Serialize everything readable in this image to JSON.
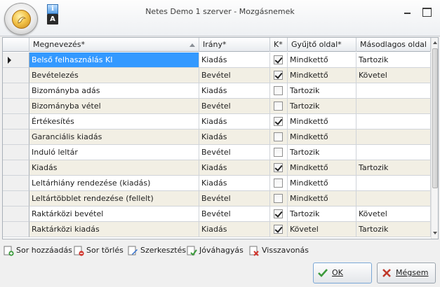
{
  "window": {
    "title": "Netes Demo 1 szerver - Mozgásnemek",
    "qat_letter": "A"
  },
  "grid": {
    "columns": [
      "Megnevezés*",
      "Irány*",
      "K*",
      "Gyűjtő oldal*",
      "Másodlagos oldal"
    ],
    "rows": [
      {
        "name": "Belső felhasználás KI",
        "dir": "Kiadás",
        "k": true,
        "side": "Mindkettő",
        "second": "Tartozik",
        "current": true
      },
      {
        "name": "Bevételezés",
        "dir": "Bevétel",
        "k": true,
        "side": "Mindkettő",
        "second": "Követel"
      },
      {
        "name": "Bizományba adás",
        "dir": "Kiadás",
        "k": false,
        "side": "Tartozik",
        "second": ""
      },
      {
        "name": "Bizományba vétel",
        "dir": "Bevétel",
        "k": false,
        "side": "Tartozik",
        "second": ""
      },
      {
        "name": "Értékesítés",
        "dir": "Kiadás",
        "k": true,
        "side": "Mindkettő",
        "second": ""
      },
      {
        "name": "Garanciális kiadás",
        "dir": "Kiadás",
        "k": false,
        "side": "Mindkettő",
        "second": ""
      },
      {
        "name": "Induló leltár",
        "dir": "Bevétel",
        "k": false,
        "side": "Tartozik",
        "second": ""
      },
      {
        "name": "Kiadás",
        "dir": "Kiadás",
        "k": true,
        "side": "Mindkettő",
        "second": "Tartozik"
      },
      {
        "name": "Leltárhiány rendezése (kiadás)",
        "dir": "Kiadás",
        "k": false,
        "side": "Mindkettő",
        "second": ""
      },
      {
        "name": "Leltártöbblet rendezése (fellelt)",
        "dir": "Bevétel",
        "k": false,
        "side": "Mindkettő",
        "second": ""
      },
      {
        "name": "Raktárközi bevétel",
        "dir": "Bevétel",
        "k": true,
        "side": "Tartozik",
        "second": "Követel"
      },
      {
        "name": "Raktárközi kiadás",
        "dir": "Kiadás",
        "k": true,
        "side": "Követel",
        "second": "Tartozik"
      }
    ]
  },
  "toolbar": {
    "add_row": "Sor hozzáadás",
    "delete_row": "Sor törlés",
    "edit": "Szerkesztés",
    "approve": "Jóváhagyás",
    "revoke": "Visszavonás"
  },
  "buttons": {
    "ok": "OK",
    "cancel": "Mégsem"
  },
  "colors": {
    "selection": "#3399ff",
    "alt_row": "#f2efe4",
    "ok_icon": "#3c9a3c",
    "cancel_icon": "#c0392b"
  }
}
